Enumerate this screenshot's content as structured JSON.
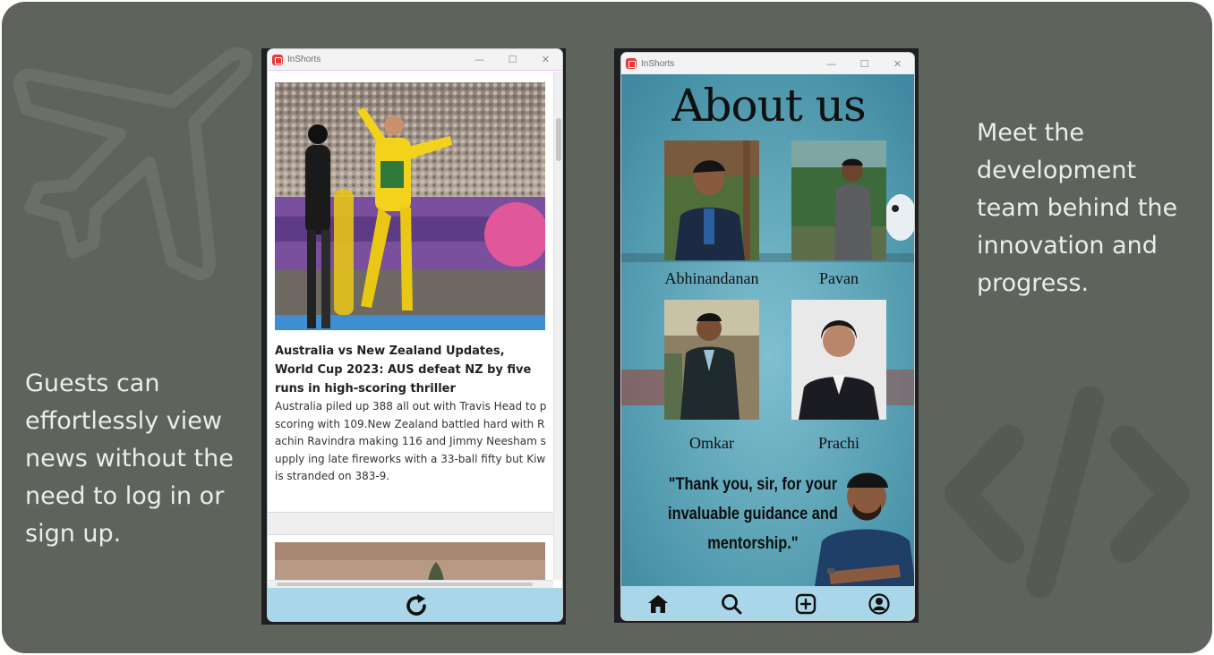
{
  "captions": {
    "left": "Guests can\neffortlessly view\nnews without the\nneed to log in or\nsign up.",
    "right": "Meet the\ndevelopment\nteam behind the\ninnovation and\nprogress."
  },
  "window1": {
    "title": "InShorts",
    "controls": {
      "minimize": "—",
      "maximize": "☐",
      "close": "✕"
    },
    "articles": [
      {
        "title": "Australia vs New Zealand Updates, World Cup 2023: AUS defeat NZ by five runs in high-scoring thriller",
        "body": "Australia piled up 388 all out with Travis Head to p scoring with 109.New Zealand battled hard with R achin Ravindra making 116 and Jimmy Neesham supply ing late fireworks with a 33-ball fifty but Kiwis stranded on 383-9."
      }
    ],
    "bottom": {
      "icon": "refresh-icon"
    }
  },
  "window2": {
    "title": "InShorts",
    "controls": {
      "minimize": "—",
      "maximize": "☐",
      "close": "✕"
    },
    "heading": "About us",
    "members": [
      {
        "name": "Abhinandanan"
      },
      {
        "name": "Pavan"
      },
      {
        "name": "Omkar"
      },
      {
        "name": "Prachi"
      }
    ],
    "quote": "\"Thank you, sir, for your invaluable guidance and mentorship.\"",
    "nav": [
      {
        "icon": "home-icon"
      },
      {
        "icon": "search-icon"
      },
      {
        "icon": "add-post-icon"
      },
      {
        "icon": "profile-icon"
      }
    ]
  },
  "colors": {
    "background": "#5e635c",
    "caption_text": "#ececec",
    "bar_blue": "#a9d6e8",
    "about_bg": "#4f9aae"
  }
}
